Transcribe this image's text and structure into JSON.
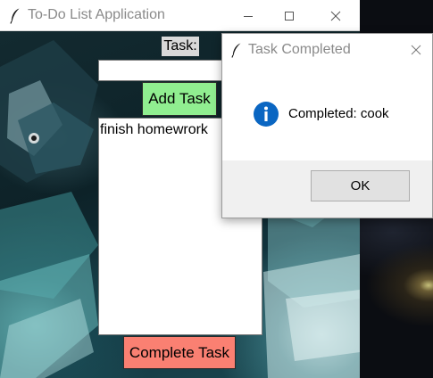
{
  "main_window": {
    "title": "To-Do List Application",
    "title_icon": "feather-icon",
    "controls": {
      "minimize_icon": "minimize-icon",
      "maximize_icon": "maximize-icon",
      "close_icon": "close-icon"
    }
  },
  "form": {
    "task_label": "Task:",
    "task_input_value": "",
    "add_button_label": "Add Task",
    "complete_button_label": "Complete Task"
  },
  "tasks": [
    "finish homewrork"
  ],
  "dialog": {
    "title": "Task Completed",
    "title_icon": "feather-icon",
    "close_icon": "close-icon",
    "info_icon": "info-icon",
    "message": "Completed: cook",
    "ok_label": "OK"
  },
  "colors": {
    "add_button": "#90ee90",
    "complete_button": "#fa8072",
    "label_bg": "#d9d9d9",
    "info_blue": "#0a66c2"
  }
}
